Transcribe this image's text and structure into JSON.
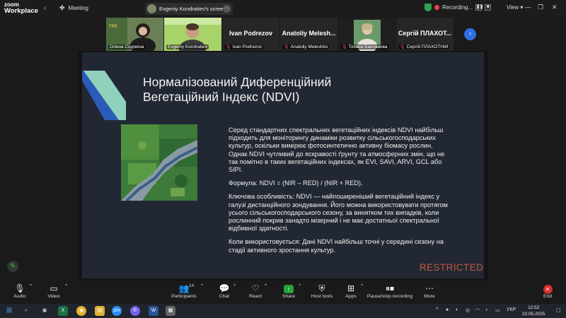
{
  "app": {
    "logo_line1": "zoom",
    "logo_line2": "Workplace",
    "meeting_label": "Meeting",
    "screen_share_label": "Evgeniy Kondratiev's screen",
    "recording_label": "Recording...",
    "view_label": "View"
  },
  "gallery": {
    "tiles": [
      {
        "name": "Олена Сидякіна",
        "muted": false,
        "type": "video"
      },
      {
        "name": "Evgeniy Kondratiev",
        "muted": false,
        "type": "video",
        "active": true
      },
      {
        "name": "Ivan Podrezov",
        "big": "Ivan Podrezov",
        "muted": true,
        "type": "name"
      },
      {
        "name": "Anatoliy Meleshko",
        "big": "Anatoliy Melesh...",
        "muted": true,
        "type": "name"
      },
      {
        "name": "Тетяна Бакланова",
        "muted": true,
        "type": "video"
      },
      {
        "name": "Сергій ПЛАХОТНІЙ",
        "big": "Сергій ПЛАХОТ...",
        "muted": true,
        "type": "name"
      }
    ]
  },
  "slide": {
    "title_line1": "Нормалізований Диференційний",
    "title_line2": "Вегетаційний Індекс (NDVI)",
    "paragraphs": [
      "Серед стандартних спектральних вегетаційних індексів NDVI найбільш підходить для моніторингу динаміки розвитку сільськогосподарських культур, оскільки вимірює фотосинтетично активну біомасу рослин. Однак NDVI чутливий до яскравості ґрунту та атмосферних змін, що не так помітно в таких вегетаційних індексах, як EVI, SAVI, ARVI, GCL або SIPI.",
      "Формула: NDVI = (NIR – RED) / (NIR + RED).",
      "Ключова особливість: NDVI — найпоширеніший вегетаційний індекс у галузі дистанційного зондування. Його можна використовувати протягом усього сільськогосподарського сезону, за винятком тих випадків, коли рослинний покрив занадто мізерний і не має достатньої спектральної відбивної здатності.",
      "Коли використовується: Дані NDVI найбільш точні у середині сезону на стадії активного зростання культур."
    ],
    "restricted_label": "RESTRICTED"
  },
  "toolbar": {
    "audio": "Audio",
    "video": "Video",
    "participants": "Participants",
    "participants_count": "14",
    "chat": "Chat",
    "react": "React",
    "share": "Share",
    "host_tools": "Host tools",
    "apps": "Apps",
    "pause_stop": "Pause/stop recording",
    "more": "More",
    "end": "End"
  },
  "taskbar": {
    "lang": "УКР",
    "time": "12:52",
    "date": "22.05.2025"
  },
  "colors": {
    "accent_green": "#3dd13d",
    "restricted": "#c0583a",
    "slide_bg": "#222833",
    "end_red": "#d92d2d"
  }
}
